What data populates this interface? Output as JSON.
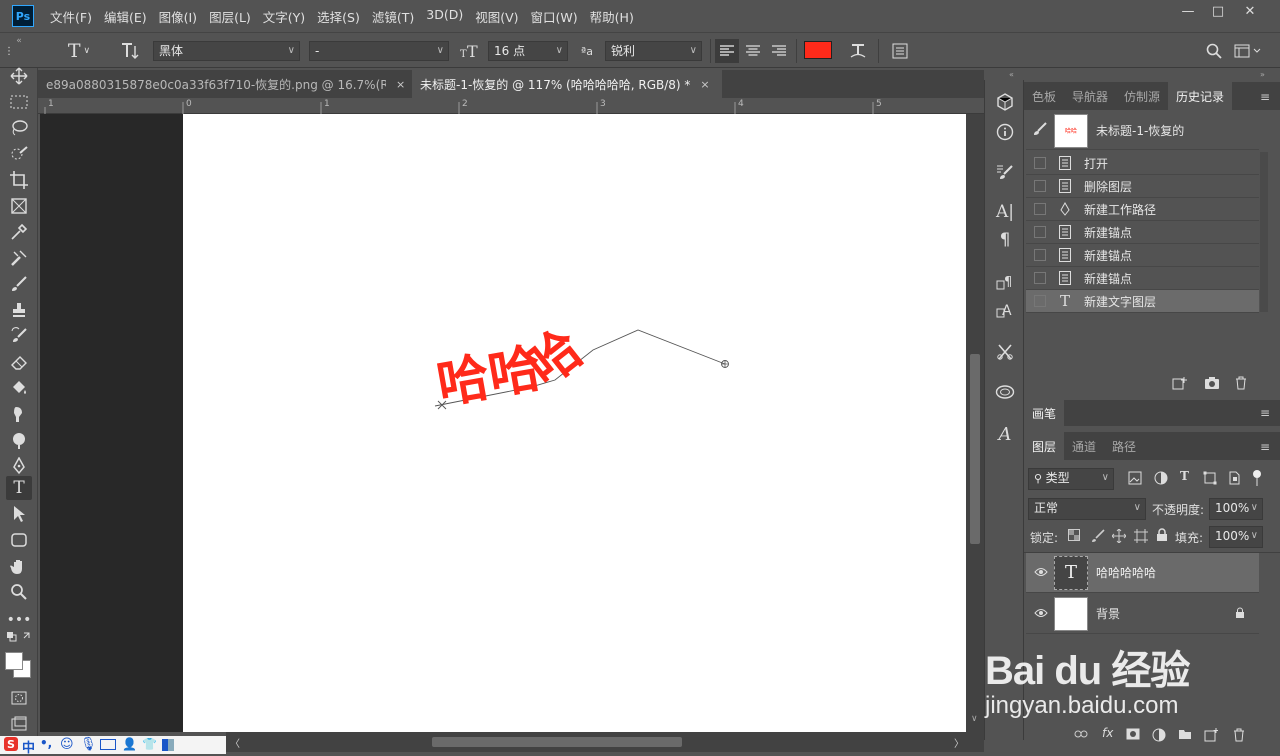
{
  "app": {
    "logo": "Ps"
  },
  "menu": [
    "文件(F)",
    "编辑(E)",
    "图像(I)",
    "图层(L)",
    "文字(Y)",
    "选择(S)",
    "滤镜(T)",
    "3D(D)",
    "视图(V)",
    "窗口(W)",
    "帮助(H)"
  ],
  "window_controls": {
    "minimize": "—",
    "maximize": "□",
    "close": "✕"
  },
  "options": {
    "text_tool_glyph": "T",
    "font_family": "黑体",
    "font_style": "-",
    "font_size": "16 点",
    "aa_icon": "ªa",
    "antialias": "锐利",
    "text_color": "#ff2a1a"
  },
  "tabs": [
    {
      "label": "e89a0880315878e0c0a33f63f710-恢复的.png @ 16.7%(RGB/8) *",
      "close": "×"
    },
    {
      "label": "未标题-1-恢复的 @ 117% (哈哈哈哈哈, RGB/8) *",
      "close": "×"
    }
  ],
  "ruler": {
    "h_labels": [
      "1",
      "0",
      "1",
      "2",
      "3",
      "4",
      "5"
    ]
  },
  "canvas": {
    "text": "哈哈哈",
    "text_color": "#ff2a1a"
  },
  "history_panel": {
    "tabs": [
      "色板",
      "导航器",
      "仿制源",
      "历史记录"
    ],
    "snapshot_label": "未标题-1-恢复的",
    "snapshot_thumb_text": "哈哈",
    "items": [
      "打开",
      "删除图层",
      "新建工作路径",
      "新建锚点",
      "新建锚点",
      "新建锚点",
      "新建文字图层"
    ],
    "text_icon": "T"
  },
  "brush_panel": {
    "tab": "画笔"
  },
  "layers_panel": {
    "tabs": [
      "图层",
      "通道",
      "路径"
    ],
    "filter_kind": "类型",
    "blend_mode": "正常",
    "opacity_label": "不透明度:",
    "opacity": "100%",
    "lock_label": "锁定:",
    "fill_label": "填充:",
    "fill": "100%",
    "layers": [
      {
        "name": "哈哈哈哈哈",
        "thumb": "T"
      },
      {
        "name": "背景",
        "thumb": ""
      }
    ],
    "footer_fx": "fx"
  },
  "ime": {
    "mode": "中",
    "punct": "•,"
  },
  "watermark": {
    "brand": "Bai du 经验",
    "url": "jingyan.baidu.com"
  }
}
